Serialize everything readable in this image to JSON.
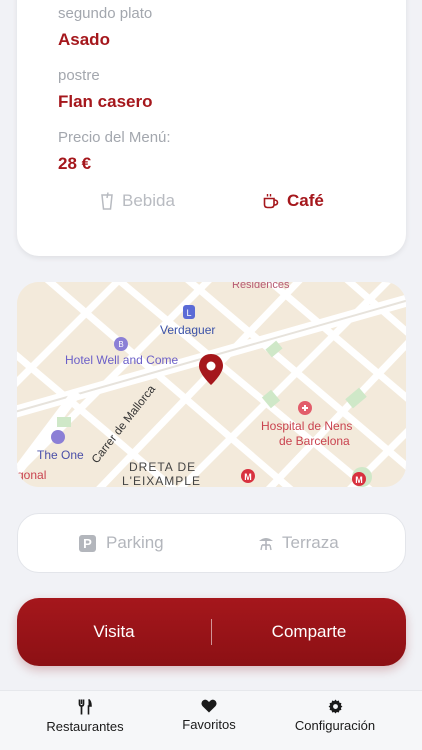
{
  "menu": {
    "courses": [
      {
        "label": "segundo plato",
        "value": "Asado"
      },
      {
        "label": "postre",
        "value": "Flan casero"
      },
      {
        "label": "Precio del Menú:",
        "value": "28 €"
      }
    ],
    "drinks": [
      {
        "label": "Bebida",
        "icon": "cup-icon",
        "active": false
      },
      {
        "label": "Café",
        "icon": "coffee-icon",
        "active": true
      }
    ]
  },
  "map": {
    "labels": {
      "residences": "Residences",
      "verdaguer": "Verdaguer",
      "hotel": "Hotel Well and Come",
      "mallorca": "Carrer de Mallorca",
      "hospital_1": "Hospital de Nens",
      "hospital_2": "de Barcelona",
      "the_one": "The One",
      "dreta_1": "DRETA DE",
      "dreta_2": "L'EIXAMPLE",
      "gonal": "gonal",
      "metro_top": "L",
      "metro_m": "M",
      "metro_m2": "M",
      "hotel_icon": "B"
    },
    "pin_color": "#a5171c"
  },
  "amenities": [
    {
      "label": "Parking",
      "icon": "parking-icon",
      "badge": "P"
    },
    {
      "label": "Terraza",
      "icon": "terrace-icon"
    }
  ],
  "actions": {
    "visit_label": "Visita",
    "share_label": "Comparte"
  },
  "tabbar": {
    "items": [
      {
        "label": "Restaurantes",
        "icon": "fork-knife-icon"
      },
      {
        "label": "Favoritos",
        "icon": "heart-icon"
      },
      {
        "label": "Configuración",
        "icon": "gear-icon"
      }
    ]
  },
  "colors": {
    "accent": "#a5171c",
    "muted": "#b3b6bc",
    "background": "#f1f2f6"
  }
}
